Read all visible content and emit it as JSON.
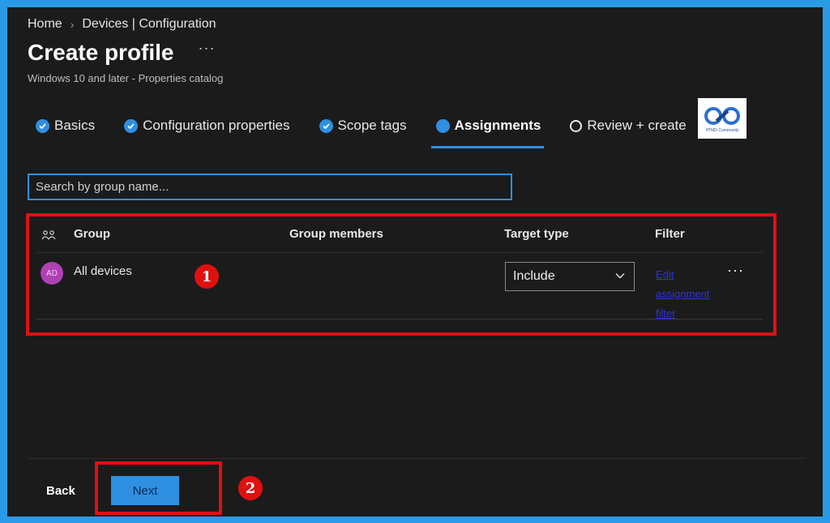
{
  "breadcrumb": [
    "Home",
    "Devices | Configuration"
  ],
  "page": {
    "title": "Create profile",
    "more": "···",
    "subtitle": "Windows 10 and later - Properties catalog"
  },
  "steps": [
    {
      "label": "Basics",
      "state": "done"
    },
    {
      "label": "Configuration properties",
      "state": "done"
    },
    {
      "label": "Scope tags",
      "state": "done"
    },
    {
      "label": "Assignments",
      "state": "current"
    },
    {
      "label": "Review + create",
      "state": "pending"
    }
  ],
  "logo": {
    "text": "HTMD Community"
  },
  "search": {
    "placeholder": "Search by group name..."
  },
  "table": {
    "headers": {
      "group": "Group",
      "members": "Group members",
      "target": "Target type",
      "filter": "Filter"
    },
    "rows": [
      {
        "avatar": "AD",
        "group": "All devices",
        "members": "",
        "target_type": "Include",
        "filter_link": "Edit assignment filter",
        "more": "···"
      }
    ]
  },
  "annotations": {
    "one": "1",
    "two": "2"
  },
  "footer": {
    "back": "Back",
    "next": "Next"
  },
  "colors": {
    "accent": "#2f8fe0",
    "highlight": "#e01010",
    "background": "#1b1b1b",
    "border": "#2a9ae6"
  }
}
